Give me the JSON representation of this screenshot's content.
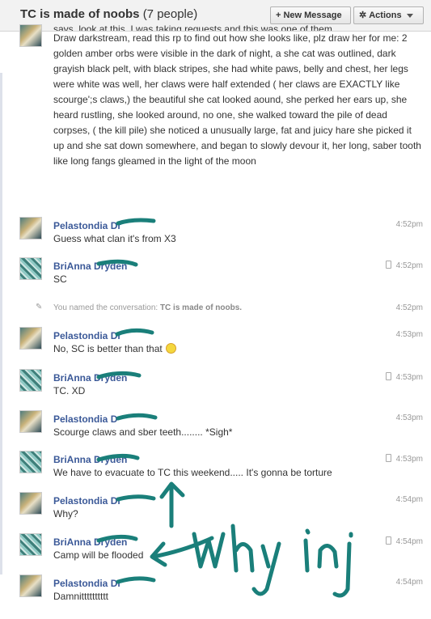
{
  "header": {
    "title": "TC is made of noobs",
    "count": "(7 people)",
    "new_message": "New Message",
    "new_message_icon": "+",
    "actions": "Actions",
    "actions_icon": "✲"
  },
  "long_message": {
    "cut_top": "says, look at this, I was taking requests and this was one of them",
    "text": "Draw darkstream, read this rp to find out how she looks like, plz draw her for me: 2 golden amber orbs were visible in the dark of night, a she cat was outlined, dark grayish black pelt, with black stripes, she had white paws, belly and chest, her legs were white was well, her claws were half extended ( her claws are EXACTLY like scourge';s claws,) the beautiful she cat looked aound, she perked her ears up, she heard rustling, she looked around, no one, she walked toward the pile of dead corpses, ( the kill pile) she noticed a unusually large, fat and juicy hare she picked it up and she sat down somewhere, and began to slowly devour it, her long, saber tooth like long fangs gleamed in the light of the moon"
  },
  "messages": [
    {
      "name": "Pelastondia Dr",
      "text": "Guess what clan it's from X3",
      "time": "4:52pm",
      "mobile": false,
      "avatar": "p"
    },
    {
      "name": "BriAnna Dryden",
      "text": "SC",
      "time": "4:52pm",
      "mobile": true,
      "avatar": "b"
    },
    {
      "name": "Pelastondia Dr",
      "text": "No, SC is better than that",
      "time": "4:53pm",
      "mobile": false,
      "avatar": "p"
    },
    {
      "name": "BriAnna Dryden",
      "text": "TC. XD",
      "time": "4:53pm",
      "mobile": true,
      "avatar": "b"
    },
    {
      "name": "Pelastondia D",
      "text": "Scourge claws and sber teeth........ *Sigh*",
      "time": "4:53pm",
      "mobile": false,
      "avatar": "p"
    },
    {
      "name": "BriAnna Dryden",
      "text": "We have to evacuate to TC this weekend..... It's gonna be torture",
      "time": "4:53pm",
      "mobile": true,
      "avatar": "b"
    },
    {
      "name": "Pelastondia Dr",
      "text": "Why?",
      "time": "4:54pm",
      "mobile": false,
      "avatar": "p"
    },
    {
      "name": "BriAnna Dryden",
      "text": "Camp will be flooded",
      "time": "4:54pm",
      "mobile": true,
      "avatar": "b"
    },
    {
      "name": "Pelastondia Dr",
      "text": "Damnitttttttttt",
      "time": "4:54pm",
      "mobile": false,
      "avatar": "p"
    }
  ],
  "system_event": {
    "prefix": "You named the conversation:",
    "value": "TC is made of noobs.",
    "time": "4:52pm"
  },
  "annotation": {
    "text": "why inj",
    "color": "#1a7f7a"
  }
}
